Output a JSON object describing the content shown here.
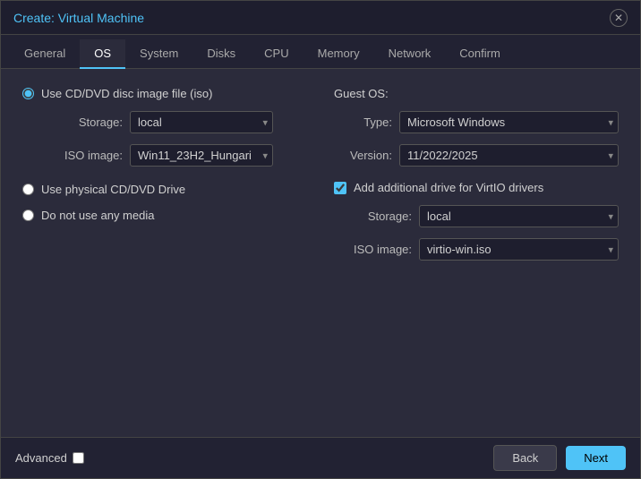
{
  "window": {
    "title": "Create: Virtual Machine",
    "close_icon": "✕"
  },
  "tabs": [
    {
      "id": "general",
      "label": "General",
      "active": false
    },
    {
      "id": "os",
      "label": "OS",
      "active": true
    },
    {
      "id": "system",
      "label": "System",
      "active": false
    },
    {
      "id": "disks",
      "label": "Disks",
      "active": false
    },
    {
      "id": "cpu",
      "label": "CPU",
      "active": false
    },
    {
      "id": "memory",
      "label": "Memory",
      "active": false
    },
    {
      "id": "network",
      "label": "Network",
      "active": false
    },
    {
      "id": "confirm",
      "label": "Confirm",
      "active": false
    }
  ],
  "os_tab": {
    "use_cd_label": "Use CD/DVD disc image file (iso)",
    "storage_label": "Storage:",
    "storage_value": "local",
    "iso_image_label": "ISO image:",
    "iso_image_value": "Win11_23H2_Hungari",
    "use_physical_label": "Use physical CD/DVD Drive",
    "do_not_use_label": "Do not use any media",
    "guest_os_label": "Guest OS:",
    "type_label": "Type:",
    "type_value": "Microsoft Windows",
    "version_label": "Version:",
    "version_value": "11/2022/2025",
    "add_drive_label": "Add additional drive for VirtIO drivers",
    "virtio_storage_label": "Storage:",
    "virtio_storage_value": "local",
    "virtio_iso_label": "ISO image:",
    "virtio_iso_value": "virtio-win.iso"
  },
  "footer": {
    "advanced_label": "Advanced",
    "back_label": "Back",
    "next_label": "Next"
  }
}
